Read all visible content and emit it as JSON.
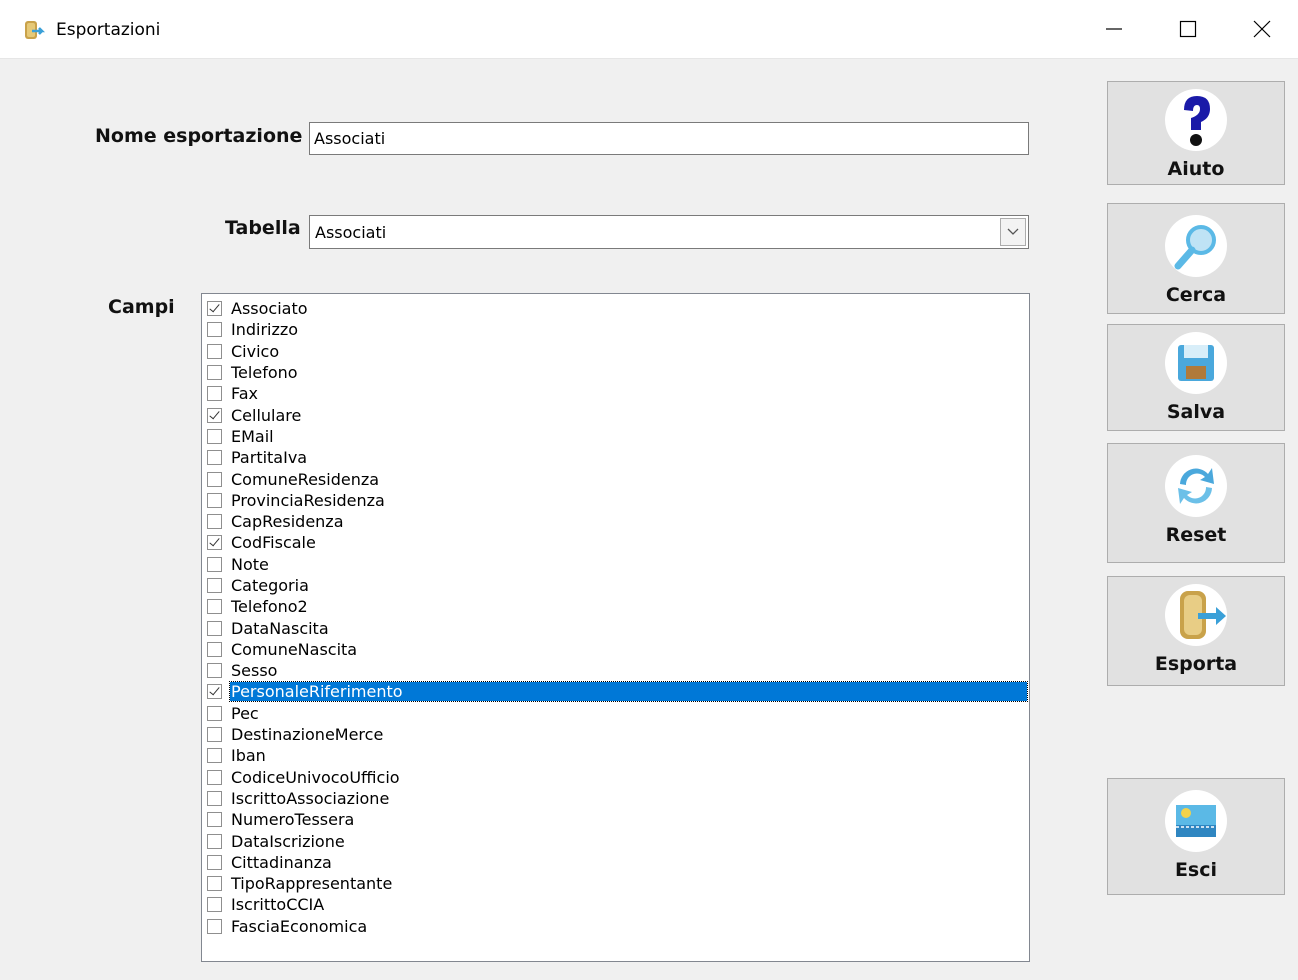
{
  "window": {
    "title": "Esportazioni"
  },
  "form": {
    "nome_label": "Nome esportazione",
    "nome_value": "Associati",
    "tabella_label": "Tabella",
    "tabella_value": "Associati",
    "campi_label": "Campi"
  },
  "fields": [
    {
      "label": "Associato",
      "checked": true
    },
    {
      "label": "Indirizzo",
      "checked": false
    },
    {
      "label": "Civico",
      "checked": false
    },
    {
      "label": "Telefono",
      "checked": false
    },
    {
      "label": "Fax",
      "checked": false
    },
    {
      "label": "Cellulare",
      "checked": true
    },
    {
      "label": "EMail",
      "checked": false
    },
    {
      "label": "PartitaIva",
      "checked": false
    },
    {
      "label": "ComuneResidenza",
      "checked": false
    },
    {
      "label": "ProvinciaResidenza",
      "checked": false
    },
    {
      "label": "CapResidenza",
      "checked": false
    },
    {
      "label": "CodFiscale",
      "checked": true
    },
    {
      "label": "Note",
      "checked": false
    },
    {
      "label": "Categoria",
      "checked": false
    },
    {
      "label": "Telefono2",
      "checked": false
    },
    {
      "label": "DataNascita",
      "checked": false
    },
    {
      "label": "ComuneNascita",
      "checked": false
    },
    {
      "label": "Sesso",
      "checked": false
    },
    {
      "label": "PersonaleRiferimento",
      "checked": true,
      "selected": true
    },
    {
      "label": "Pec",
      "checked": false
    },
    {
      "label": "DestinazioneMerce",
      "checked": false
    },
    {
      "label": "Iban",
      "checked": false
    },
    {
      "label": "CodiceUnivocoUfficio",
      "checked": false
    },
    {
      "label": "IscrittoAssociazione",
      "checked": false
    },
    {
      "label": "NumeroTessera",
      "checked": false
    },
    {
      "label": "DataIscrizione",
      "checked": false
    },
    {
      "label": "Cittadinanza",
      "checked": false
    },
    {
      "label": "TipoRappresentante",
      "checked": false
    },
    {
      "label": "IscrittoCCIA",
      "checked": false
    },
    {
      "label": "FasciaEconomica",
      "checked": false
    }
  ],
  "actions": {
    "aiuto": "Aiuto",
    "cerca": "Cerca",
    "salva": "Salva",
    "reset": "Reset",
    "esporta": "Esporta",
    "esci": "Esci"
  },
  "colors": {
    "selection": "#0078d7",
    "button_face": "#e1e1e1",
    "window_bg": "#f0f0f0"
  }
}
